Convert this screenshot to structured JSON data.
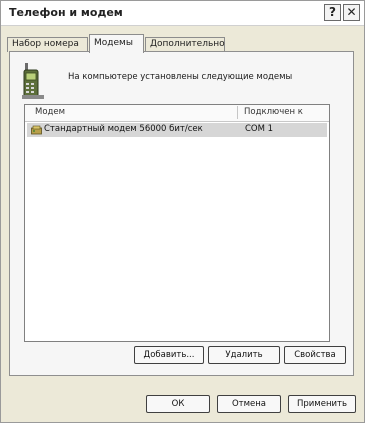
{
  "window": {
    "title": "Телефон и модем",
    "help_label": "?",
    "close_label": "✕"
  },
  "tabs": [
    {
      "label": "Набор номера"
    },
    {
      "label": "Модемы"
    },
    {
      "label": "Дополнительно"
    }
  ],
  "panel": {
    "info_text": "На компьютере установлены следующие модемы"
  },
  "list": {
    "headers": {
      "model": "Модем",
      "port": "Подключен к"
    },
    "rows": [
      {
        "model": "Стандартный модем 56000 бит/сек",
        "port": "COM 1"
      }
    ]
  },
  "buttons": {
    "add": "Добавить...",
    "delete": "Удалить",
    "properties": "Свойства",
    "ok": "ОК",
    "cancel": "Отмена",
    "apply": "Применить"
  },
  "icons": {
    "phone": "phone-icon",
    "modem": "modem-icon"
  },
  "colors": {
    "window_bg": "#ece9d8",
    "panel_bg": "#f6f6f6",
    "selection_bg": "#d6d6d6"
  }
}
